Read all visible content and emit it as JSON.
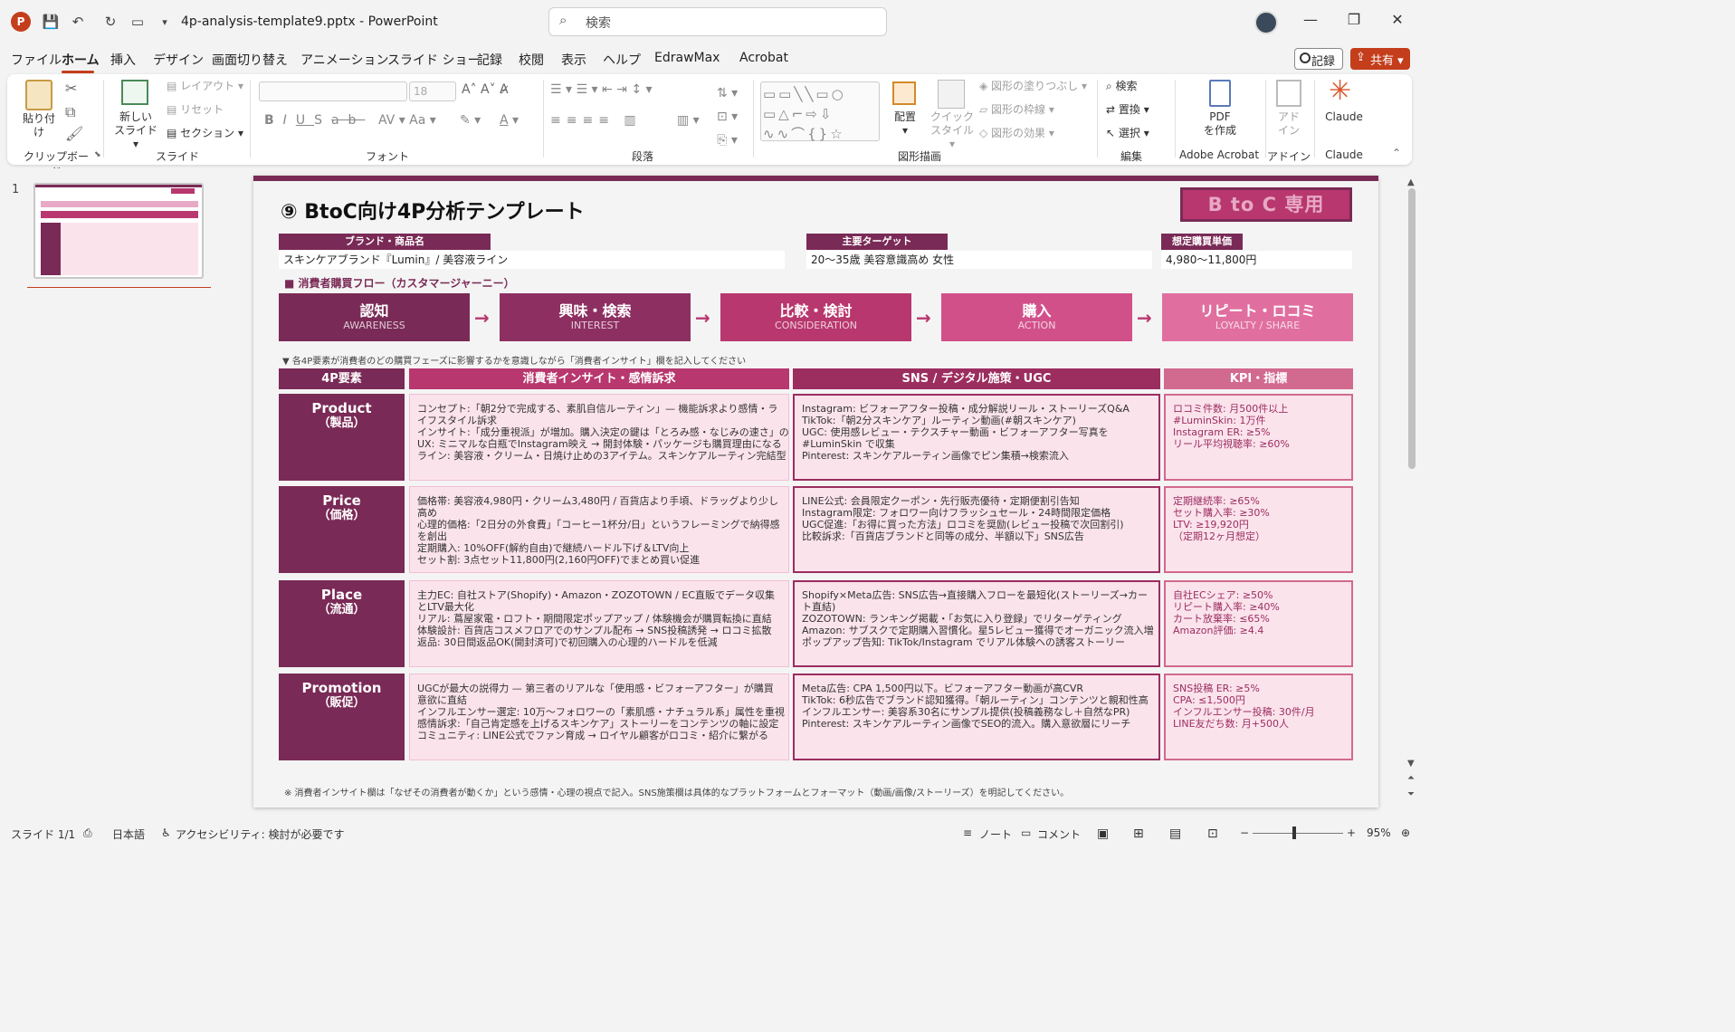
{
  "app": {
    "filename": "4p-analysis-template9.pptx",
    "separator": "-",
    "app_name": "PowerPoint",
    "search_placeholder": "検索"
  },
  "menu": [
    "ファイル",
    "ホーム",
    "挿入",
    "デザイン",
    "画面切り替え",
    "アニメーション",
    "スライド ショー",
    "記録",
    "校閲",
    "表示",
    "ヘルプ",
    "EdrawMax",
    "Acrobat"
  ],
  "record_label": "記録",
  "share_label": "共有",
  "ribbon": {
    "clipboard": {
      "paste": "貼り付け",
      "group": "クリップボード"
    },
    "slides": {
      "new_slide_1": "新しい",
      "new_slide_2": "スライド",
      "layout": "レイアウト",
      "reset": "リセット",
      "section": "セクション",
      "group": "スライド"
    },
    "font": {
      "size": "18",
      "group": "フォント"
    },
    "paragraph": {
      "group": "段落"
    },
    "drawing": {
      "arrange": "配置",
      "quick_1": "クイック",
      "quick_2": "スタイル",
      "fill": "図形の塗りつぶし",
      "outline": "図形の枠線",
      "effect": "図形の効果",
      "group": "図形描画"
    },
    "editing": {
      "find": "検索",
      "replace": "置換",
      "select": "選択",
      "group": "編集"
    },
    "acrobat": {
      "pdf_1": "PDF",
      "pdf_2": "を作成",
      "group": "Adobe Acrobat"
    },
    "addin": {
      "label_1": "アド",
      "label_2": "イン",
      "group": "アドイン"
    },
    "claude": {
      "label": "Claude",
      "group": "Claude"
    }
  },
  "thumb_num": "1",
  "slide": {
    "title": "⑨ BtoC向け4P分析テンプレート",
    "badge": "B to C 専用",
    "brand_label": "ブランド・商品名",
    "brand_value": "スキンケアブランド『Lumin』/ 美容液ライン",
    "target_label": "主要ターゲット",
    "target_value": "20〜35歳 美容意識高め 女性",
    "price_label": "想定購買単価",
    "price_value": "4,980〜11,800円",
    "flow_label": "■ 消費者購買フロー（カスタマージャーニー）",
    "stages": [
      {
        "title": "認知",
        "sub": "AWARENESS",
        "color": "#7a2a56"
      },
      {
        "title": "興味・検索",
        "sub": "INTEREST",
        "color": "#8e2f62"
      },
      {
        "title": "比較・検討",
        "sub": "CONSIDERATION",
        "color": "#b8376e"
      },
      {
        "title": "購入",
        "sub": "ACTION",
        "color": "#d2508a"
      },
      {
        "title": "リピート・ロコミ",
        "sub": "LOYALTY / SHARE",
        "color": "#e06fa0"
      }
    ],
    "arrow": "→",
    "note_top": "▼ 各4P要素が消費者のどの購買フェーズに影響するかを意識しながら「消費者インサイト」欄を記入してください",
    "col_headers": [
      "4P要素",
      "消費者インサイト・感情訴求",
      "SNS / デジタル施策・UGC",
      "KPI・指標"
    ],
    "rows": [
      {
        "name": "Product",
        "sub": "（製品）",
        "insight": [
          "コンセプト:「朝2分で完成する、素肌自信ルーティン」— 機能訴求より感情・ライフスタイル訴求",
          "インサイト:「成分重視派」が増加。購入決定の鍵は「とろみ感・なじみの速さ」の体感",
          "UX: ミニマルな白瓶でInstagram映え → 開封体験・パッケージも購買理由になる",
          "ライン: 美容液・クリーム・日焼け止めの3アイテム。スキンケアルーティン完結型"
        ],
        "sns": [
          "Instagram: ビフォーアフター投稿・成分解説リール・ストーリーズQ&A",
          "TikTok:「朝2分スキンケア」ルーティン動画(#朝スキンケア)",
          "UGC: 使用感レビュー・テクスチャー動画・ビフォーアフター写真を #LuminSkin で収集",
          "Pinterest: スキンケアルーティン画像でピン集積→検索流入"
        ],
        "kpi": [
          "ロコミ件数: 月500件以上",
          "#LuminSkin: 1万件",
          "Instagram ER: ≥5%",
          "リール平均視聴率: ≥60%"
        ]
      },
      {
        "name": "Price",
        "sub": "（価格）",
        "insight": [
          "価格帯: 美容液4,980円・クリーム3,480円 / 百貨店より手頃、ドラッグより少し高め",
          "心理的価格:「2日分の外食費」「コーヒー1杯分/日」というフレーミングで納得感を創出",
          "定期購入: 10%OFF(解約自由)で継続ハードル下げ＆LTV向上",
          "セット割: 3点セット11,800円(2,160円OFF)でまとめ買い促進"
        ],
        "sns": [
          "LINE公式: 会員限定クーポン・先行販売優待・定期便割引告知",
          "Instagram限定: フォロワー向けフラッシュセール・24時間限定価格",
          "UGC促進:「お得に買った方法」ロコミを奨励(レビュー投稿で次回割引)",
          "比較訴求:「百貨店ブランドと同等の成分、半額以下」SNS広告"
        ],
        "kpi": [
          "定期継続率: ≥65%",
          "セット購入率: ≥30%",
          "LTV: ≥19,920円",
          "（定期12ヶ月想定）"
        ]
      },
      {
        "name": "Place",
        "sub": "（流通）",
        "insight": [
          "主力EC: 自社ストア(Shopify)・Amazon・ZOZOTOWN / EC直販でデータ収集とLTV最大化",
          "リアル: 蔦屋家電・ロフト・期間限定ポップアップ / 体験機会が購買転換に直結",
          "体験設計: 百貨店コスメフロアでのサンプル配布 → SNS投稿誘発 → ロコミ拡散",
          "返品: 30日間返品OK(開封済可)で初回購入の心理的ハードルを低減"
        ],
        "sns": [
          "Shopify×Meta広告: SNS広告→直接購入フローを最短化(ストーリーズ→カート直結)",
          "ZOZOTOWN: ランキング掲載・「お気に入り登録」でリターゲティング",
          "Amazon: サブスクで定期購入習慣化。星5レビュー獲得でオーガニック流入増",
          "ポップアップ告知: TikTok/Instagram でリアル体験への誘客ストーリー"
        ],
        "kpi": [
          "自社ECシェア: ≥50%",
          "リピート購入率: ≥40%",
          "カート放棄率: ≤65%",
          "Amazon評価: ≥4.4"
        ]
      },
      {
        "name": "Promotion",
        "sub": "（販促）",
        "insight": [
          "UGCが最大の説得力 — 第三者のリアルな「使用感・ビフォーアフター」が購買意欲に直結",
          "インフルエンサー選定: 10万〜フォロワーの「素肌感・ナチュラル系」属性を重視",
          "感情訴求:「自己肯定感を上げるスキンケア」ストーリーをコンテンツの軸に設定",
          "コミュニティ: LINE公式でファン育成 → ロイヤル顧客がロコミ・紹介に繋がる"
        ],
        "sns": [
          "Meta広告: CPA 1,500円以下。ビフォーアフター動画が高CVR",
          "TikTok: 6秒広告でブランド認知獲得。「朝ルーティン」コンテンツと親和性高",
          "インフルエンサー: 美容系30名にサンプル提供(投稿義務なし＋自然なPR)",
          "Pinterest: スキンケアルーティン画像でSEO的流入。購入意欲層にリーチ"
        ],
        "kpi": [
          "SNS投稿 ER: ≥5%",
          "CPA: ≤1,500円",
          "インフルエンサー投稿: 30件/月",
          "LINE友だち数: 月+500人"
        ]
      }
    ],
    "note_bottom": "※ 消費者インサイト欄は「なぜその消費者が動くか」という感情・心理の視点で記入。SNS施策欄は具体的なプラットフォームとフォーマット（動画/画像/ストーリーズ）を明記してください。"
  },
  "status": {
    "slide": "スライド 1/1",
    "lang": "日本語",
    "access": "アクセシビリティ: 検討が必要です",
    "notes": "ノート",
    "comments": "コメント",
    "zoom": "95%"
  }
}
